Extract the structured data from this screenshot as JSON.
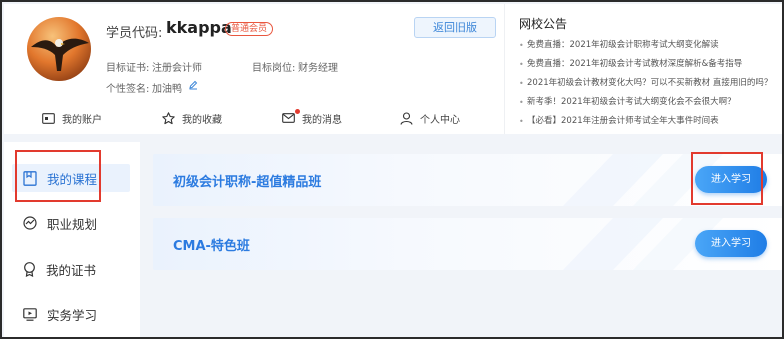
{
  "profile": {
    "code_label": "学员代码:",
    "code_value": "kkappa",
    "member_badge": "普通会员",
    "back_button": "返回旧版",
    "target_cert_label": "目标证书:",
    "target_cert_value": "注册会计师",
    "target_job_label": "目标岗位:",
    "target_job_value": "财务经理",
    "signature_label": "个性签名:",
    "signature_value": "加油鸭"
  },
  "nav": {
    "account": "我的账户",
    "favorites": "我的收藏",
    "messages": "我的消息",
    "personal": "个人中心"
  },
  "notice": {
    "title": "网校公告",
    "items": [
      "免费直播：2021年初级会计职称考试大纲变化解读",
      "免费直播：2021年初级会计考试教材深度解析&备考指导",
      "2021年初级会计教材变化大吗？可以不买新教材 直接用旧的吗？",
      "新考季！2021年初级会计考试大纲变化会不会很大啊？",
      "【必看】2021年注册会计师考试全年大事件时间表"
    ]
  },
  "sidebar": {
    "items": [
      {
        "label": "我的课程",
        "icon": "book-icon"
      },
      {
        "label": "职业规划",
        "icon": "compass-icon"
      },
      {
        "label": "我的证书",
        "icon": "certificate-icon"
      },
      {
        "label": "实务学习",
        "icon": "screen-icon"
      }
    ]
  },
  "courses": [
    {
      "name": "初级会计职称-超值精品班",
      "button": "进入学习"
    },
    {
      "name": "CMA-特色班",
      "button": "进入学习"
    }
  ],
  "colors": {
    "accent": "#2c7be0",
    "highlight_box": "#e23a2e",
    "badge": "#e9573f"
  }
}
